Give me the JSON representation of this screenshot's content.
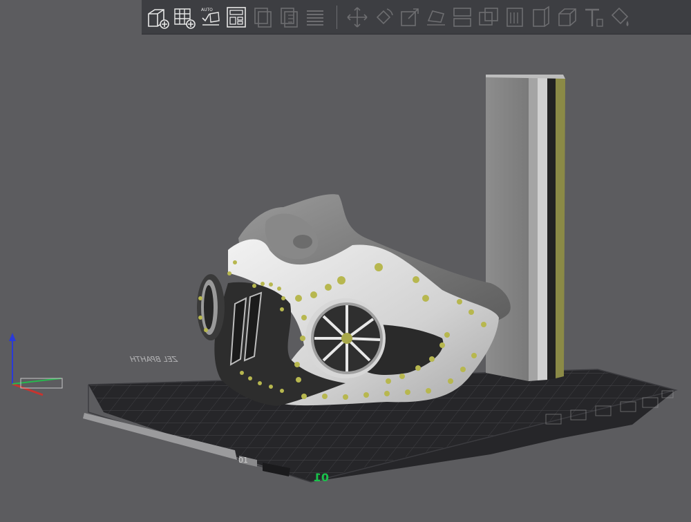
{
  "toolbar": {
    "buttons": [
      {
        "name": "add-object-button",
        "icon": "add-cube-icon",
        "enabled": true
      },
      {
        "name": "add-instance-button",
        "icon": "grid-add-icon",
        "enabled": true
      },
      {
        "name": "auto-arrange-button",
        "icon": "auto-arrange-icon",
        "enabled": true,
        "badge": "AUTO"
      },
      {
        "name": "layout-button",
        "icon": "layout-icon",
        "enabled": true
      },
      {
        "name": "copy-button",
        "icon": "copy-icon",
        "enabled": false
      },
      {
        "name": "paste-button",
        "icon": "paste-icon",
        "enabled": false
      },
      {
        "name": "layers-button",
        "icon": "layers-icon",
        "enabled": false
      },
      {
        "name": "move-button",
        "icon": "move-icon",
        "enabled": false
      },
      {
        "name": "rotate-button",
        "icon": "rotate-icon",
        "enabled": false
      },
      {
        "name": "scale-button",
        "icon": "scale-icon",
        "enabled": false
      },
      {
        "name": "lay-on-face-button",
        "icon": "lay-flat-icon",
        "enabled": false
      },
      {
        "name": "split-button",
        "icon": "split-icon",
        "enabled": false
      },
      {
        "name": "cut-button",
        "icon": "cut-icon",
        "enabled": false
      },
      {
        "name": "support-paint-button",
        "icon": "support-icon",
        "enabled": false
      },
      {
        "name": "seam-paint-button",
        "icon": "seam-icon",
        "enabled": false
      },
      {
        "name": "shape-button",
        "icon": "shape-icon",
        "enabled": false
      },
      {
        "name": "text-button",
        "icon": "text-icon",
        "enabled": false
      },
      {
        "name": "color-paint-button",
        "icon": "paint-icon",
        "enabled": false
      }
    ],
    "auto_badge": "AUTO"
  },
  "bed": {
    "plate_number": "01",
    "brand_text": "ZEL BPAHTH",
    "plate_label": "01"
  },
  "colors": {
    "background": "#5c5c5f",
    "bed": "#2a2a2d",
    "grid": "#49494d",
    "mask_light": "#d6d6d6",
    "mask_dark": "#2b2b2b",
    "rivet": "#b7b74f",
    "plate_green": "#19c24b"
  }
}
